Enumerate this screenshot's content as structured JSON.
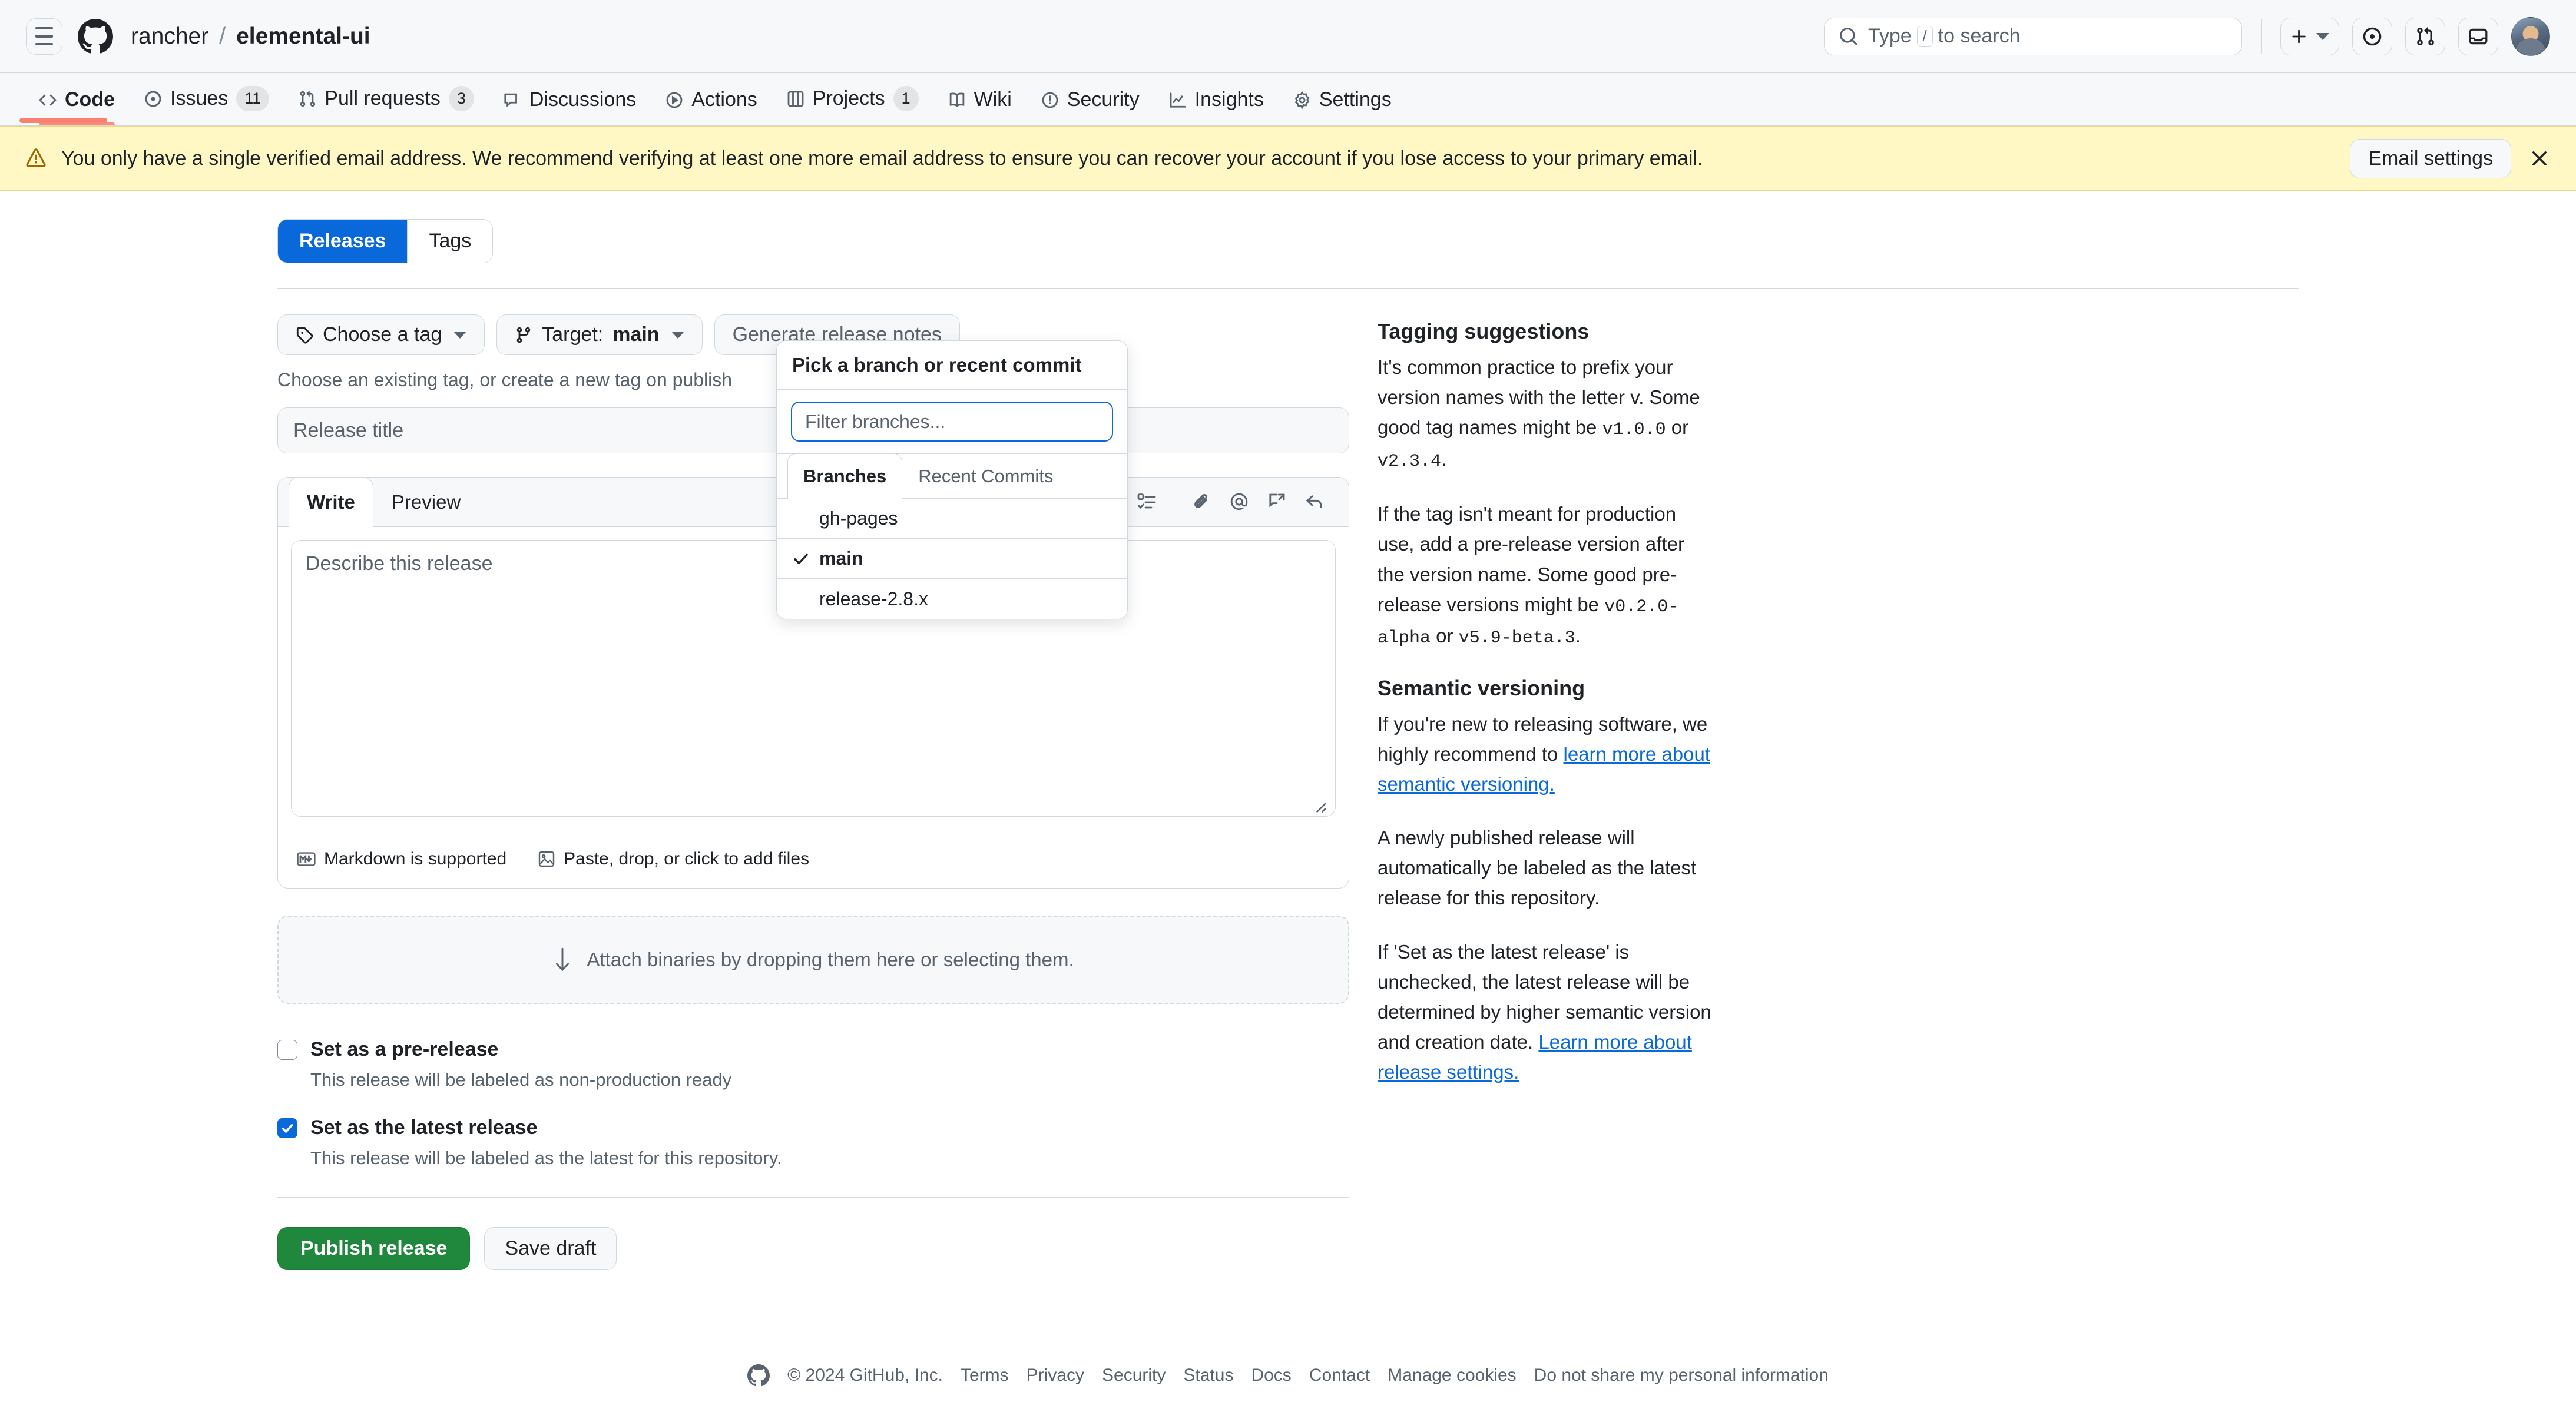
{
  "header": {
    "owner": "rancher",
    "separator": "/",
    "repo": "elemental-ui",
    "search_placeholder": "Type / to search",
    "search_key_hint": "/",
    "search_prefix": "Type",
    "search_suffix": "to search"
  },
  "repo_nav": [
    {
      "label": "Code",
      "icon": "code-icon",
      "count": "",
      "active": true
    },
    {
      "label": "Issues",
      "icon": "issue-opened-icon",
      "count": "11",
      "active": false
    },
    {
      "label": "Pull requests",
      "icon": "git-pull-request-icon",
      "count": "3",
      "active": false
    },
    {
      "label": "Discussions",
      "icon": "comment-discussion-icon",
      "count": "",
      "active": false
    },
    {
      "label": "Actions",
      "icon": "play-icon",
      "count": "",
      "active": false
    },
    {
      "label": "Projects",
      "icon": "project-icon",
      "count": "1",
      "active": false
    },
    {
      "label": "Wiki",
      "icon": "book-icon",
      "count": "",
      "active": false
    },
    {
      "label": "Security",
      "icon": "shield-icon",
      "count": "",
      "active": false
    },
    {
      "label": "Insights",
      "icon": "graph-icon",
      "count": "",
      "active": false
    },
    {
      "label": "Settings",
      "icon": "gear-icon",
      "count": "",
      "active": false
    }
  ],
  "flash": {
    "message": "You only have a single verified email address. We recommend verifying at least one more email address to ensure you can recover your account if you lose access to your primary email.",
    "action_label": "Email settings"
  },
  "release_tabs": [
    {
      "label": "Releases",
      "active": true
    },
    {
      "label": "Tags",
      "active": false
    }
  ],
  "form": {
    "choose_tag_label": "Choose a tag",
    "target_label": "Target:",
    "target_value": "main",
    "generate_notes_label": "Generate release notes",
    "tag_hint": "Choose an existing tag, or create a new tag on publish",
    "title_placeholder": "Release title",
    "title_value": "",
    "body_placeholder": "Describe this release",
    "body_value": "",
    "editor_tabs": [
      {
        "label": "Write",
        "active": true
      },
      {
        "label": "Preview",
        "active": false
      }
    ],
    "toolbar_icons": [
      "heading-icon",
      "bold-icon",
      "italic-icon",
      "quote-icon",
      "code-icon",
      "link-icon",
      "ordered-list-icon",
      "unordered-list-icon",
      "task-list-icon",
      "attach-file-icon",
      "mention-icon",
      "saved-reply-icon",
      "reply-icon"
    ],
    "markdown_supported_label": "Markdown is supported",
    "paste_drop_label": "Paste, drop, or click to add files",
    "dropzone_label": "Attach binaries by dropping them here or selecting them.",
    "prerelease": {
      "label": "Set as a pre-release",
      "desc": "This release will be labeled as non-production ready",
      "checked": false
    },
    "latest": {
      "label": "Set as the latest release",
      "desc": "This release will be labeled as the latest for this repository.",
      "checked": true
    },
    "publish_label": "Publish release",
    "save_draft_label": "Save draft"
  },
  "branch_dropdown": {
    "heading": "Pick a branch or recent commit",
    "filter_placeholder": "Filter branches...",
    "filter_value": "",
    "tabs": [
      {
        "label": "Branches",
        "active": true
      },
      {
        "label": "Recent Commits",
        "active": false
      }
    ],
    "items": [
      {
        "name": "gh-pages",
        "selected": false
      },
      {
        "name": "main",
        "selected": true
      },
      {
        "name": "release-2.8.x",
        "selected": false
      }
    ]
  },
  "sidebar": {
    "tagging": {
      "title": "Tagging suggestions",
      "p1_a": "It's common practice to prefix your version names with the letter v. Some good tag names might be ",
      "p1_code1": "v1.0.0",
      "p1_b": " or ",
      "p1_code2": "v2.3.4",
      "p1_c": ".",
      "p2_a": "If the tag isn't meant for production use, add a pre-release version after the version name. Some good pre-release versions might be ",
      "p2_code1": "v0.2.0-alpha",
      "p2_b": " or ",
      "p2_code2": "v5.9-beta.3",
      "p2_c": "."
    },
    "semver": {
      "title": "Semantic versioning",
      "p1_a": "If you're new to releasing software, we highly recommend to ",
      "p1_link": "learn more about semantic versioning.",
      "p2": "A newly published release will automatically be labeled as the latest release for this repository.",
      "p3_a": "If 'Set as the latest release' is unchecked, the latest release will be determined by higher semantic version and creation date. ",
      "p3_link": "Learn more about release settings."
    }
  },
  "footer": {
    "copyright": "© 2024 GitHub, Inc.",
    "links": [
      "Terms",
      "Privacy",
      "Security",
      "Status",
      "Docs",
      "Contact",
      "Manage cookies",
      "Do not share my personal information"
    ]
  },
  "colors": {
    "accent": "#0969da",
    "success": "#1f883d",
    "warning_bg": "#fff8c5",
    "progress": "#fa8072",
    "active_tab_underline": "#fd8c73"
  }
}
